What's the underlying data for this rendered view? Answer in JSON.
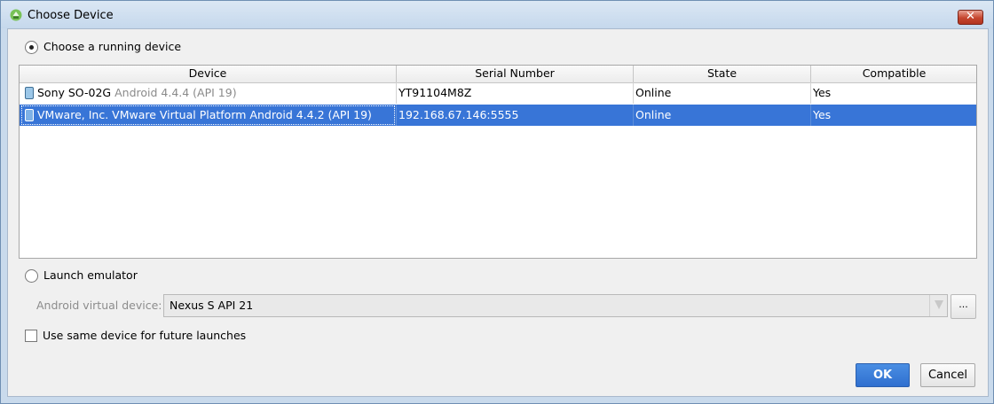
{
  "window": {
    "title": "Choose Device"
  },
  "running": {
    "radio_label": "Choose a running device",
    "selected": true
  },
  "table": {
    "columns": [
      "Device",
      "Serial Number",
      "State",
      "Compatible"
    ],
    "rows": [
      {
        "device": "Sony SO-02G",
        "api": "Android 4.4.4 (API 19)",
        "serial": "YT91104M8Z",
        "state": "Online",
        "compatible": "Yes",
        "selected": false
      },
      {
        "device": "VMware, Inc. VMware Virtual Platform",
        "api": "Android 4.4.2 (API 19)",
        "serial": "192.168.67.146:5555",
        "state": "Online",
        "compatible": "Yes",
        "selected": true
      }
    ]
  },
  "emulator": {
    "radio_label": "Launch emulator",
    "avd_label": "Android virtual device:",
    "avd_value": "Nexus S API 21",
    "browse_label": "..."
  },
  "future": {
    "checkbox_label": "Use same device for future launches",
    "checked": false
  },
  "buttons": {
    "ok": "OK",
    "cancel": "Cancel"
  },
  "colors": {
    "selection": "#3875d7",
    "ok_button": "#3a7bd5",
    "close_button": "#c6452e"
  }
}
